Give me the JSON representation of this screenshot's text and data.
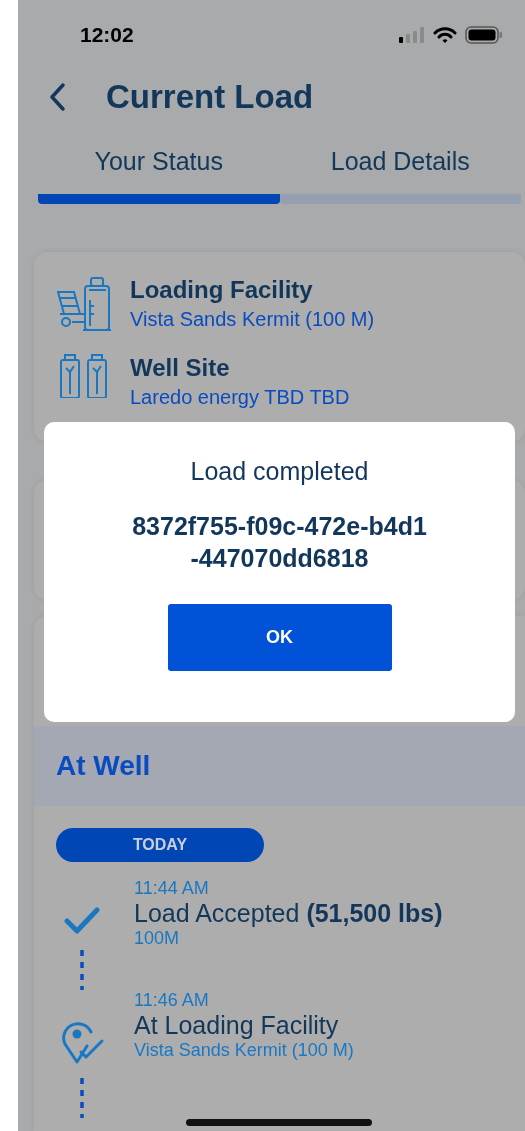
{
  "status_bar": {
    "time": "12:02"
  },
  "header": {
    "title": "Current Load"
  },
  "tabs": [
    {
      "label": "Your Status",
      "selected": true
    },
    {
      "label": "Load Details",
      "selected": false
    }
  ],
  "route": [
    {
      "kind": "facility",
      "title": "Loading Facility",
      "subtitle": "Vista Sands Kermit (100 M)"
    },
    {
      "kind": "well",
      "title": "Well Site",
      "subtitle": "Laredo energy TBD TBD"
    }
  ],
  "section": {
    "title": "At Well"
  },
  "timeline": {
    "date": "TODAY",
    "events": [
      {
        "kind": "check",
        "time": "11:44 AM",
        "title": "Load Accepted **(51,500 lbs)**",
        "detail": "100M"
      },
      {
        "kind": "pin",
        "time": "11:46 AM",
        "title": "At Loading Facility",
        "detail": "Vista Sands Kermit (100 M)"
      }
    ]
  },
  "dialog": {
    "title": "Load completed",
    "message": "8372f755-f09c-472e-b4d1-447070dd6818",
    "button": "OK"
  }
}
